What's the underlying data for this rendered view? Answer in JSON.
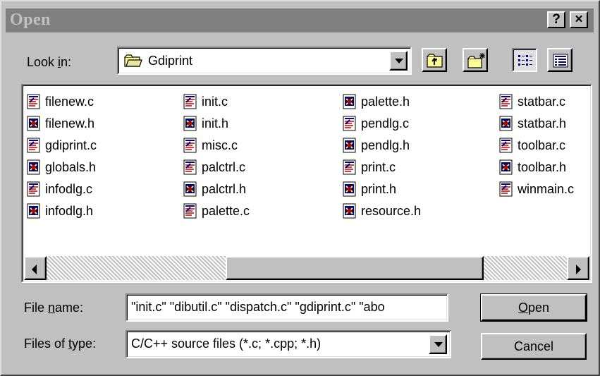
{
  "window": {
    "title": "Open",
    "help_button": "?",
    "close_button": "×"
  },
  "look_in": {
    "label_pre": "Look ",
    "label_accel": "i",
    "label_post": "n:",
    "value": "Gdiprint"
  },
  "toolbar": {
    "up_folder": "up-one-level",
    "new_folder": "create-new-folder",
    "list_view": "list",
    "details_view": "details"
  },
  "files": {
    "col1": [
      "filenew.c",
      "filenew.h",
      "gdiprint.c",
      "globals.h",
      "infodlg.c",
      "infodlg.h"
    ],
    "col2": [
      "init.c",
      "init.h",
      "misc.c",
      "palctrl.c",
      "palctrl.h",
      "palette.c"
    ],
    "col3": [
      "palette.h",
      "pendlg.c",
      "pendlg.h",
      "print.c",
      "print.h",
      "resource.h"
    ],
    "col4": [
      "statbar.c",
      "statbar.h",
      "toolbar.c",
      "toolbar.h",
      "winmain.c"
    ]
  },
  "file_name": {
    "label_pre": "File ",
    "label_accel": "n",
    "label_post": "ame:",
    "value": "\"init.c\" \"dibutil.c\" \"dispatch.c\" \"gdiprint.c\" \"abo"
  },
  "file_type": {
    "label_pre": "Files of ",
    "label_accel": "t",
    "label_post": "ype:",
    "value": "C/C++ source files (*.c; *.cpp; *.h)"
  },
  "buttons": {
    "open_accel": "O",
    "open_rest": "pen",
    "cancel": "Cancel"
  }
}
